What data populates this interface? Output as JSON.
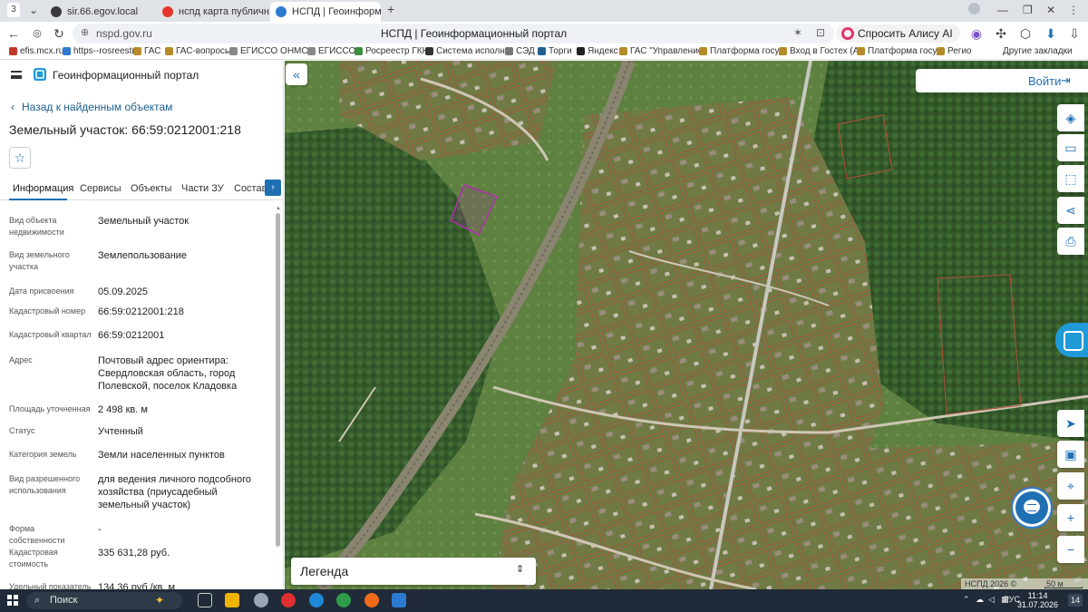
{
  "browser": {
    "tab_counter": "3",
    "tabs": [
      {
        "title": "sir.66.egov.local",
        "color": "#3a3a3a"
      },
      {
        "title": "нспд карта публичная кад",
        "color": "#e6372f"
      },
      {
        "title": "НСПД | Геоинформацио",
        "color": "#2c7bd0",
        "active": true
      }
    ],
    "url": "nspd.gov.ru",
    "page_title": "НСПД | Геоинформационный портал",
    "alisa_label": "Спросить Алису AI",
    "bookmarks": [
      {
        "label": "efis.mcx.ru",
        "color": "#c0392b"
      },
      {
        "label": "https--rosreestr",
        "color": "#2c7bd0"
      },
      {
        "label": "ГАС",
        "color": "#b58b2a"
      },
      {
        "label": "ГАС-вопросы",
        "color": "#b58b2a"
      },
      {
        "label": "ЕГИССО ОНМСЗ",
        "color": "#888888"
      },
      {
        "label": "ЕГИССО",
        "color": "#888888"
      },
      {
        "label": "Росреестр ГКН",
        "color": "#3b8e3b"
      },
      {
        "label": "Система исполне",
        "color": "#333333"
      },
      {
        "label": "СЭД",
        "color": "#777777"
      },
      {
        "label": "Торги",
        "color": "#1f5f8f"
      },
      {
        "label": "Яндекс",
        "color": "#222222"
      },
      {
        "label": "ГАС \"Управление",
        "color": "#b58b2a"
      },
      {
        "label": "Платформа госуд",
        "color": "#b58b2a"
      },
      {
        "label": "Вход в Гостех (Ау",
        "color": "#b58b2a"
      },
      {
        "label": "Платформа госуд",
        "color": "#b58b2a"
      },
      {
        "label": "Регио",
        "color": "#b58b2a"
      }
    ],
    "other_bookmarks": "Другие закладки"
  },
  "panel": {
    "portal_title": "Геоинформационный портал",
    "back_link": "Назад к найденным объектам",
    "parcel_title": "Земельный участок: 66:59:0212001:218",
    "favorite_icon": "star-icon",
    "tabs": [
      {
        "label": "Информация",
        "active": true
      },
      {
        "label": "Сервисы"
      },
      {
        "label": "Объекты"
      },
      {
        "label": "Части ЗУ"
      },
      {
        "label": "Состав"
      }
    ],
    "properties": [
      {
        "label": "Вид объекта недвижимости",
        "value": "Земельный участок"
      },
      {
        "label": "Вид земельного участка",
        "value": "Землепользование"
      },
      {
        "label": "Дата присвоения",
        "value": "05.09.2025"
      },
      {
        "label": "Кадастровый номер",
        "value": "66:59:0212001:218"
      },
      {
        "label": "Кадастровый квартал",
        "value": "66:59:0212001"
      },
      {
        "label": "Адрес",
        "value": "Почтовый адрес ориентира: Свердловская область, город Полевской, поселок Кладовка"
      },
      {
        "label": "Площадь уточненная",
        "value": "2 498 кв. м"
      },
      {
        "label": "Статус",
        "value": "Учтенный"
      },
      {
        "label": "Категория земель",
        "value": "Земли населенных пунктов"
      },
      {
        "label": "Вид разрешенного использования",
        "value": "для ведения личного подсобного хозяйства (приусадебный земельный участок)"
      },
      {
        "label": "Форма собственности",
        "value": "-"
      },
      {
        "label": "Кадастровая стоимость",
        "value": "335 631,28 руб."
      },
      {
        "label": "Удельный показатель",
        "value": "134,36 руб./кв. м"
      }
    ]
  },
  "map": {
    "login_label": "Войти",
    "legend_label": "Легенда",
    "copyright": "НСПД 2026 ©",
    "scale_label": "50 м",
    "parcel_highlight_color": "#b02fb0",
    "right_tools": [
      "layers-icon",
      "ruler-icon",
      "select-area-icon",
      "share-icon",
      "print-icon"
    ],
    "bottom_tools": [
      "locate-icon",
      "basemap-icon",
      "geolocation-icon",
      "zoom-in-icon",
      "zoom-out-icon"
    ]
  },
  "taskbar": {
    "search_label": "Поиск",
    "language": "РУС",
    "time": "11:14",
    "date": "31.07.2026",
    "notifications": "14"
  }
}
